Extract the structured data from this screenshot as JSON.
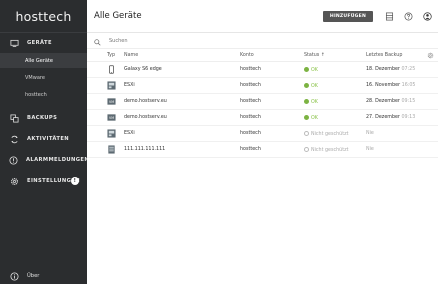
{
  "sidebar": {
    "logo": "hosttech",
    "devices_label": "GERÄTE",
    "sub_items": [
      {
        "label": "Alle Geräte"
      },
      {
        "label": "VMware"
      },
      {
        "label": "hosttech"
      }
    ],
    "backups_label": "BACKUPS",
    "activities_label": "AKTIVITÄTEN",
    "alarms_label": "ALARMMELDUNGEN",
    "settings_label": "EINSTELLUNGEN",
    "settings_badge": "!",
    "about_label": "Über"
  },
  "header": {
    "title": "Alle Geräte",
    "add_label": "HINZUFÜGEN"
  },
  "search": {
    "placeholder": "Suchen"
  },
  "table": {
    "columns": {
      "type": "Typ",
      "name": "Name",
      "account": "Konto",
      "status": "Status ↑",
      "last_backup": "Letztes Backup"
    },
    "rows": [
      {
        "type": "phone",
        "name": "Galaxy S6 edge",
        "account": "hosttech",
        "status": "OK",
        "status_kind": "ok",
        "backup_date": "18. Dezember",
        "backup_time": "07:25"
      },
      {
        "type": "esxi",
        "name": "ESXi",
        "account": "hosttech",
        "status": "OK",
        "status_kind": "ok",
        "backup_date": "16. November",
        "backup_time": "16:05"
      },
      {
        "type": "vm",
        "name": "demo.hostserv.eu",
        "account": "hosttech",
        "status": "OK",
        "status_kind": "ok",
        "backup_date": "28. Dezember",
        "backup_time": "09:15"
      },
      {
        "type": "vm",
        "name": "demo.hostserv.eu",
        "account": "hosttech",
        "status": "OK",
        "status_kind": "ok",
        "backup_date": "27. Dezember",
        "backup_time": "09:13"
      },
      {
        "type": "esxi",
        "name": "ESXi",
        "account": "hosttech",
        "status": "Nicht geschützt",
        "status_kind": "ns",
        "backup_date": "Nie",
        "backup_time": ""
      },
      {
        "type": "server",
        "name": "111.111.111.111",
        "account": "hosttech",
        "status": "Nicht geschützt",
        "status_kind": "ns",
        "backup_date": "Nie",
        "backup_time": ""
      }
    ]
  },
  "colors": {
    "sidebar": "#2b2d2f",
    "ok": "#7cb342",
    "button": "#555555"
  }
}
